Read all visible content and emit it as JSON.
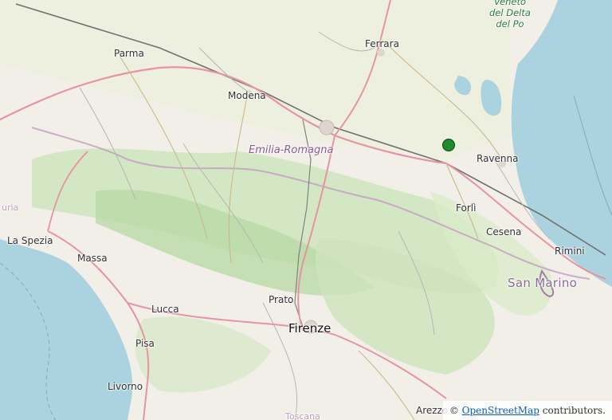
{
  "map": {
    "marker_color": "#1f8a2e",
    "labels": {
      "parma": "Parma",
      "modena": "Modena",
      "ferrara": "Ferrara",
      "ravenna": "Ravenna",
      "forli": "Forlì",
      "cesena": "Cesena",
      "rimini": "Rimini",
      "san_marino": "San Marino",
      "emilia_romagna": "Emilia-Romagna",
      "la_spezia": "La Spezia",
      "massa": "Massa",
      "lucca": "Lucca",
      "pisa": "Pisa",
      "livorno": "Livorno",
      "prato": "Prato",
      "firenze": "Firenze",
      "arezzo": "Arezzo",
      "toscana": "Toscana",
      "liguria": "uria",
      "delta_park_line1": "Veneto",
      "delta_park_line2": "del Delta",
      "delta_park_line3": "del Po"
    }
  },
  "attribution": {
    "prefix": "©",
    "link_text": "OpenStreetMap",
    "suffix": "contributors."
  }
}
